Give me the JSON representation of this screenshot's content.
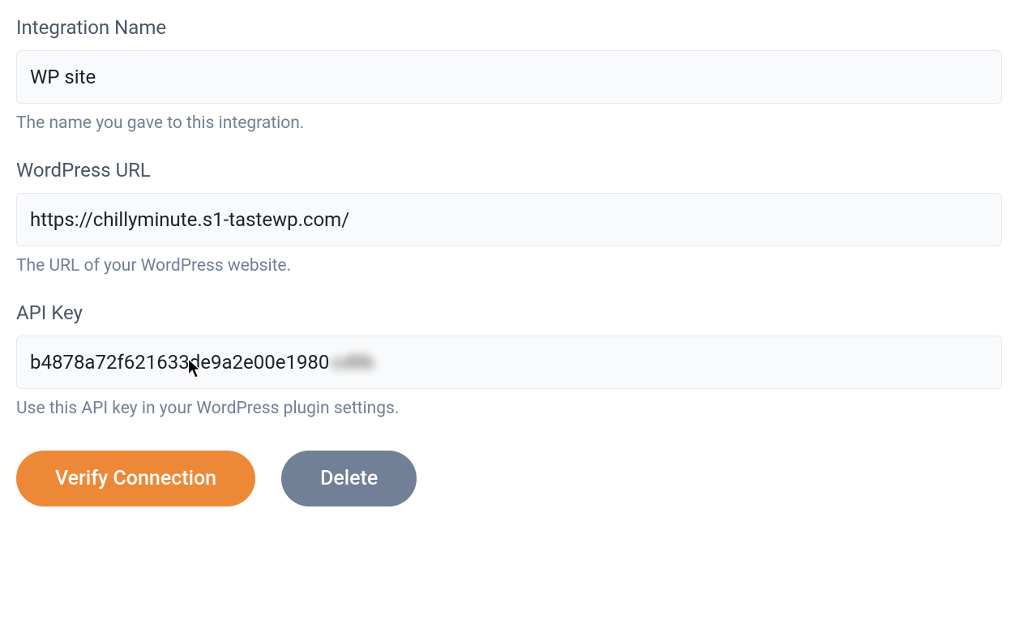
{
  "integration_name": {
    "label": "Integration Name",
    "value": "WP site",
    "help": "The name you gave to this integration."
  },
  "wordpress_url": {
    "label": "WordPress URL",
    "value": "https://chillyminute.s1-tastewp.com/",
    "help": "The URL of your WordPress website."
  },
  "api_key": {
    "label": "API Key",
    "value_visible": "b4878a72f621633de9a2e00e1980",
    "value_obscured": "cd8b",
    "help": "Use this API key in your WordPress plugin settings."
  },
  "buttons": {
    "verify": "Verify Connection",
    "delete": "Delete"
  }
}
